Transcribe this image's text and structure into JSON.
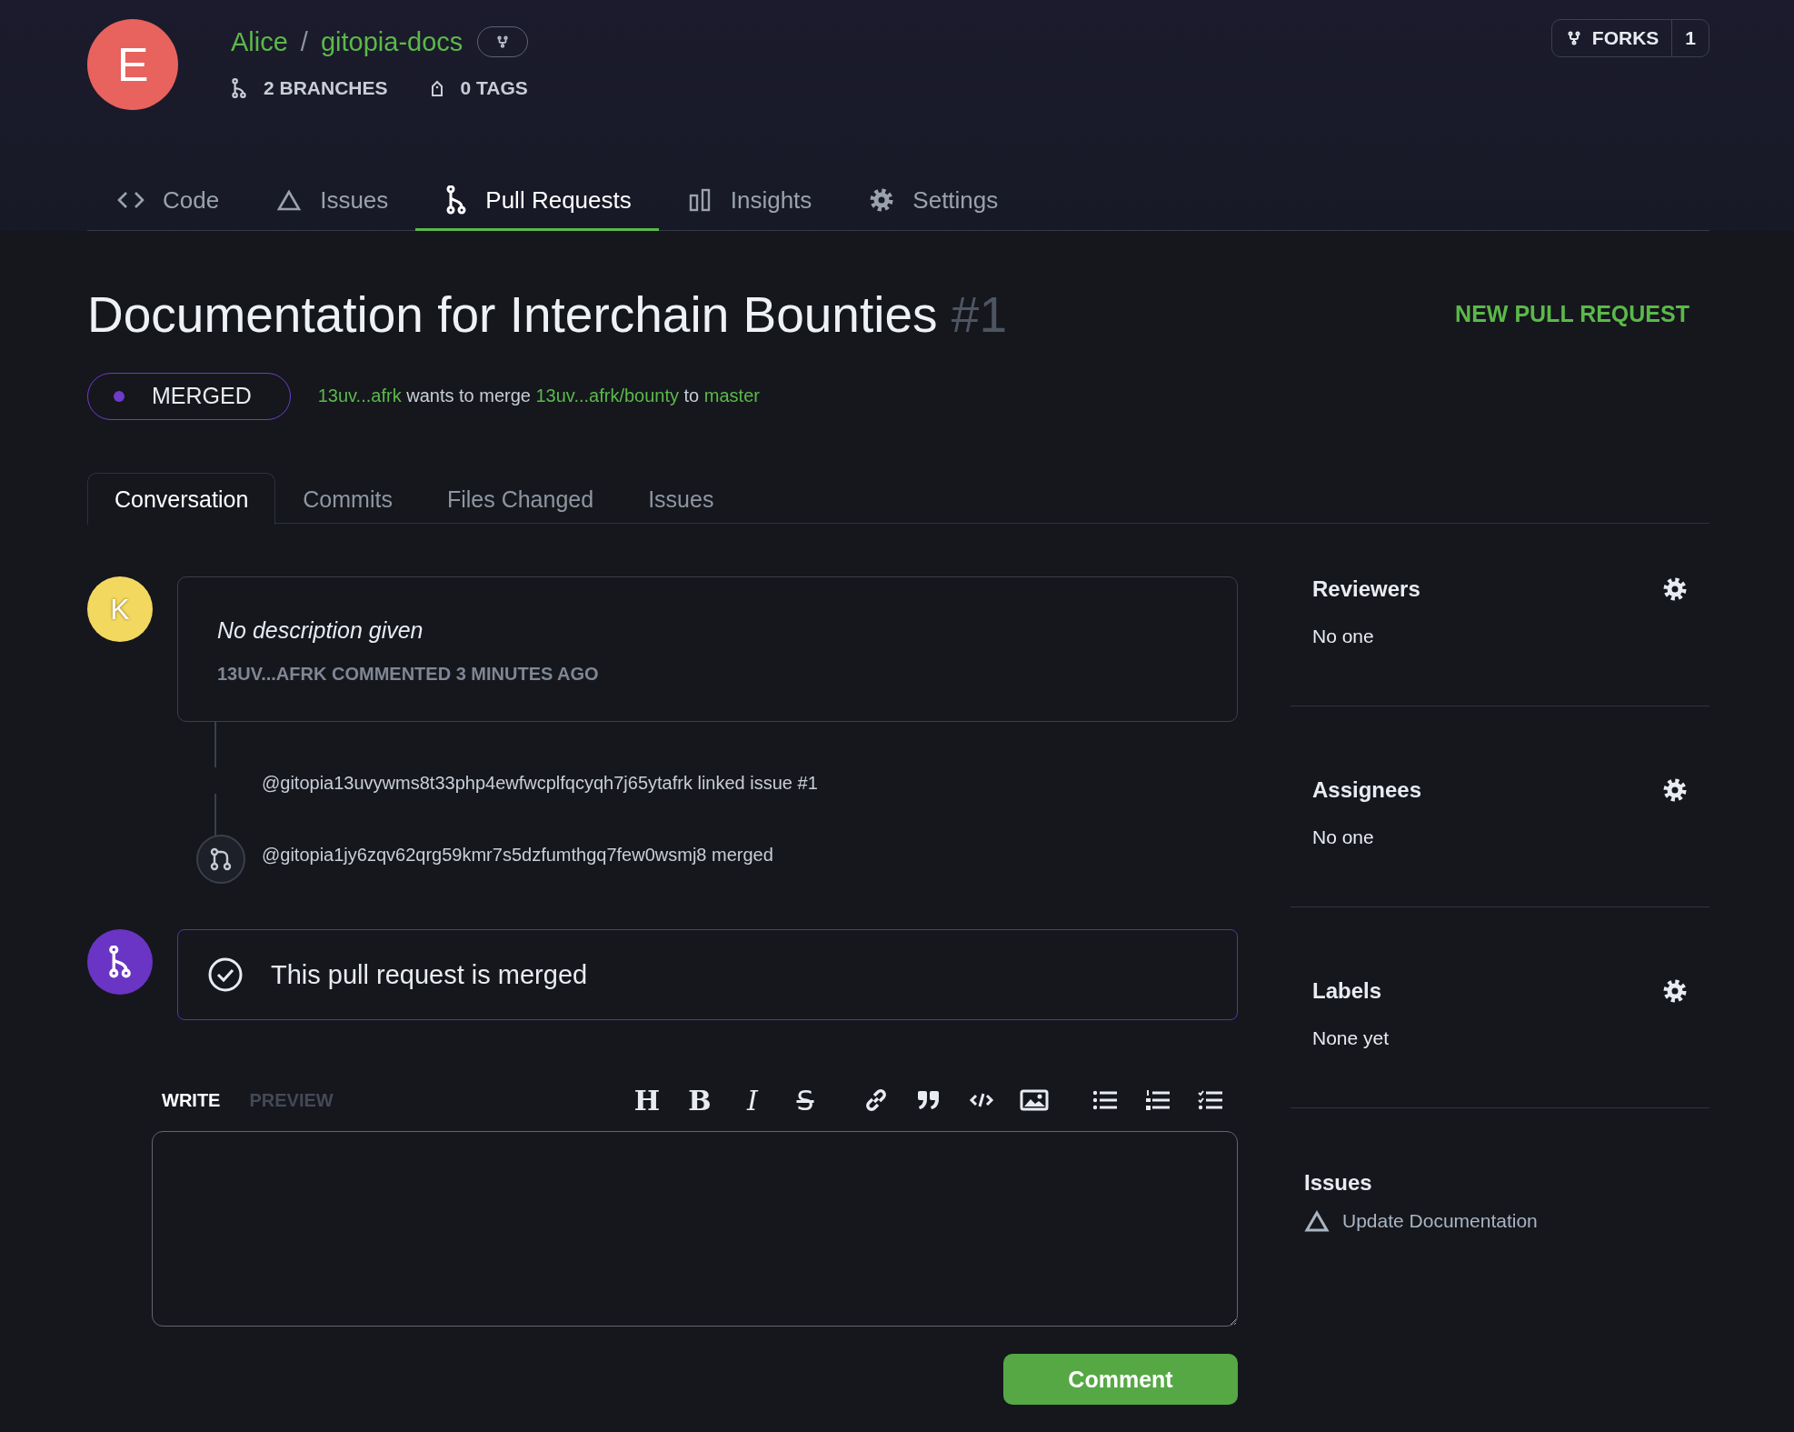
{
  "repo": {
    "avatar_letter": "E",
    "owner": "Alice",
    "separator": "/",
    "name": "gitopia-docs",
    "branches": "2 BRANCHES",
    "tags": "0 TAGS"
  },
  "forks": {
    "label": "FORKS",
    "count": "1"
  },
  "nav": [
    {
      "label": "Code",
      "kind": "code",
      "selected": false
    },
    {
      "label": "Issues",
      "kind": "issue",
      "selected": false
    },
    {
      "label": "Pull Requests",
      "kind": "pull",
      "selected": true
    },
    {
      "label": "Insights",
      "kind": "insights",
      "selected": false
    },
    {
      "label": "Settings",
      "kind": "settings",
      "selected": false
    }
  ],
  "pull_request": {
    "title": "Documentation for Interchain Bounties",
    "number": "#1",
    "new_button": "NEW PULL REQUEST",
    "status": "MERGED",
    "merge_line": [
      {
        "text": "13uv...afrk",
        "link": true
      },
      {
        "text": "wants to merge",
        "link": false
      },
      {
        "text": "13uv...afrk/bounty",
        "link": true
      },
      {
        "text": "to",
        "link": false
      },
      {
        "text": "master",
        "link": true
      }
    ]
  },
  "subtabs": [
    {
      "label": "Conversation",
      "selected": true
    },
    {
      "label": "Commits",
      "selected": false
    },
    {
      "label": "Files Changed",
      "selected": false
    },
    {
      "label": "Issues",
      "selected": false
    }
  ],
  "comment": {
    "avatar_letter": "K",
    "body": "No description given",
    "meta": "13UV...AFRK COMMENTED 3 MINUTES AGO"
  },
  "events": [
    {
      "kind": "link",
      "text": "@gitopia13uvywms8t33php4ewfwcplfqcyqh7j65ytafrk linked issue #1"
    },
    {
      "kind": "merge",
      "text": "@gitopia1jy6zqv62qrg59kmr7s5dzfumthgq7few0wsmj8 merged"
    }
  ],
  "merged_notice": "This pull request is merged",
  "editor": {
    "tabs": [
      {
        "label": "WRITE",
        "selected": true
      },
      {
        "label": "PREVIEW",
        "selected": false
      }
    ],
    "toolbar": [
      {
        "kind": "heading",
        "label": "H"
      },
      {
        "kind": "bold",
        "label": "B"
      },
      {
        "kind": "italic",
        "label": "I"
      },
      {
        "kind": "strike",
        "label": "S"
      },
      {
        "kind": "link"
      },
      {
        "kind": "quote"
      },
      {
        "kind": "code"
      },
      {
        "kind": "image"
      },
      {
        "kind": "ul"
      },
      {
        "kind": "ol"
      },
      {
        "kind": "task"
      }
    ],
    "button": "Comment"
  },
  "sidebar": {
    "sections": [
      {
        "title": "Reviewers",
        "value": "No one"
      },
      {
        "title": "Assignees",
        "value": "No one"
      },
      {
        "title": "Labels",
        "value": "None yet"
      }
    ],
    "issues": {
      "title": "Issues",
      "items": [
        "Update Documentation"
      ]
    }
  }
}
